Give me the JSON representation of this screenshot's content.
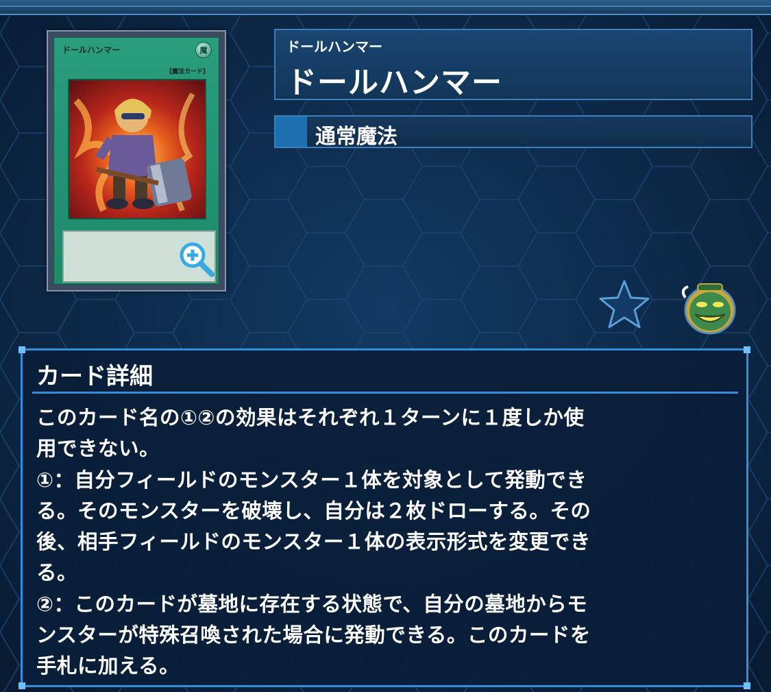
{
  "card": {
    "image_name": "ドールハンマー",
    "image_attribute": "魔",
    "image_type": "【魔法カード】"
  },
  "name": {
    "ruby": "ドールハンマー",
    "main": "ドールハンマー"
  },
  "spell_type": "通常魔法",
  "icons": {
    "favorite": "star-icon",
    "pot": "pot-of-greed-icon",
    "zoom": "zoom-in-icon"
  },
  "detail": {
    "title": "カード詳細",
    "lines": [
      "このカード名の①②の効果はそれぞれ１ターンに１度しか使",
      "用できない。",
      "①：自分フィールドのモンスター１体を対象として発動でき",
      "る。そのモンスターを破壊し、自分は２枚ドローする。その",
      "後、相手フィールドのモンスター１体の表示形式を変更でき",
      "る。",
      "②：このカードが墓地に存在する状態で、自分の墓地からモ",
      "ンスターが特殊召喚された場合に発動できる。このカードを",
      "手札に加える。"
    ]
  },
  "colors": {
    "background": "#0b2442",
    "panel_border": "#2f8fd8",
    "spell_card_green": "#1d8a6a",
    "type_marker": "#1e6fb0"
  }
}
